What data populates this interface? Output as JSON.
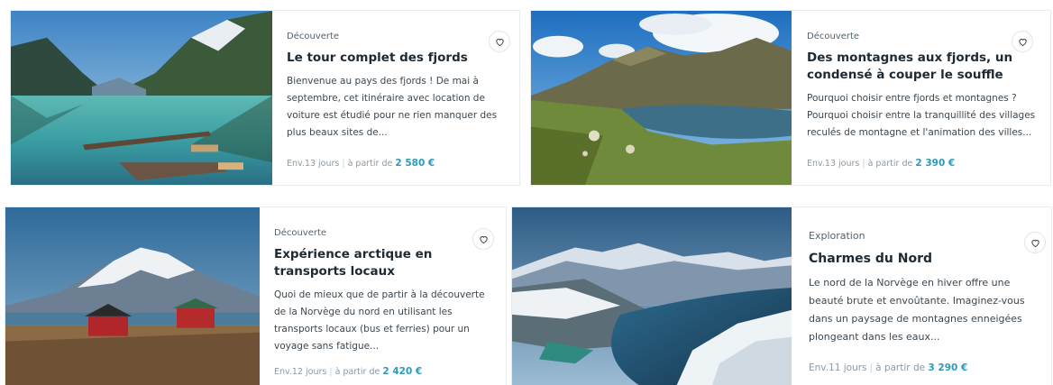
{
  "cards": [
    {
      "category": "Découverte",
      "title": "Le tour complet des fjords",
      "description": "Bienvenue au pays des fjords ! De mai à septembre, cet itinéraire avec location de voiture est étudié pour ne rien manquer des plus beaux sites de...",
      "duration": "Env.13 jours",
      "price_prefix": "à partir de",
      "price": "2 580 €",
      "favorite_icon": "heart-icon",
      "image": "fjord-lake-pier"
    },
    {
      "category": "Découverte",
      "title": "Des montagnes aux fjords, un condensé à couper le souffle",
      "description": "Pourquoi choisir entre fjords et montagnes ? Pourquoi choisir entre la tranquillité des villages reculés de montagne et l'animation des villes...",
      "duration": "Env.13 jours",
      "price_prefix": "à partir de",
      "price": "2 390 €",
      "favorite_icon": "heart-icon",
      "image": "mountain-lake-sheep"
    },
    {
      "category": "Découverte",
      "title": "Expérience arctique en transports locaux",
      "description": "Quoi de mieux que de partir à la découverte de la Norvège du nord en utilisant les transports locaux (bus et ferries) pour un voyage sans fatigue...",
      "duration": "Env.12 jours",
      "price_prefix": "à partir de",
      "price": "2 420 €",
      "favorite_icon": "heart-icon",
      "image": "arctic-red-cabins"
    },
    {
      "category": "Exploration",
      "title": "Charmes du Nord",
      "description": "Le nord de la Norvège en hiver offre une beauté brute et envoûtante. Imaginez-vous dans un paysage de montagnes enneigées plongeant dans les eaux...",
      "duration": "Env.11 jours",
      "price_prefix": "à partir de",
      "price": "3 290 €",
      "favorite_icon": "heart-icon",
      "image": "snowy-fjord-aerial"
    }
  ],
  "colors": {
    "price": "#2a9cb8",
    "text": "#1e2a33",
    "muted": "#8a9aa5"
  }
}
